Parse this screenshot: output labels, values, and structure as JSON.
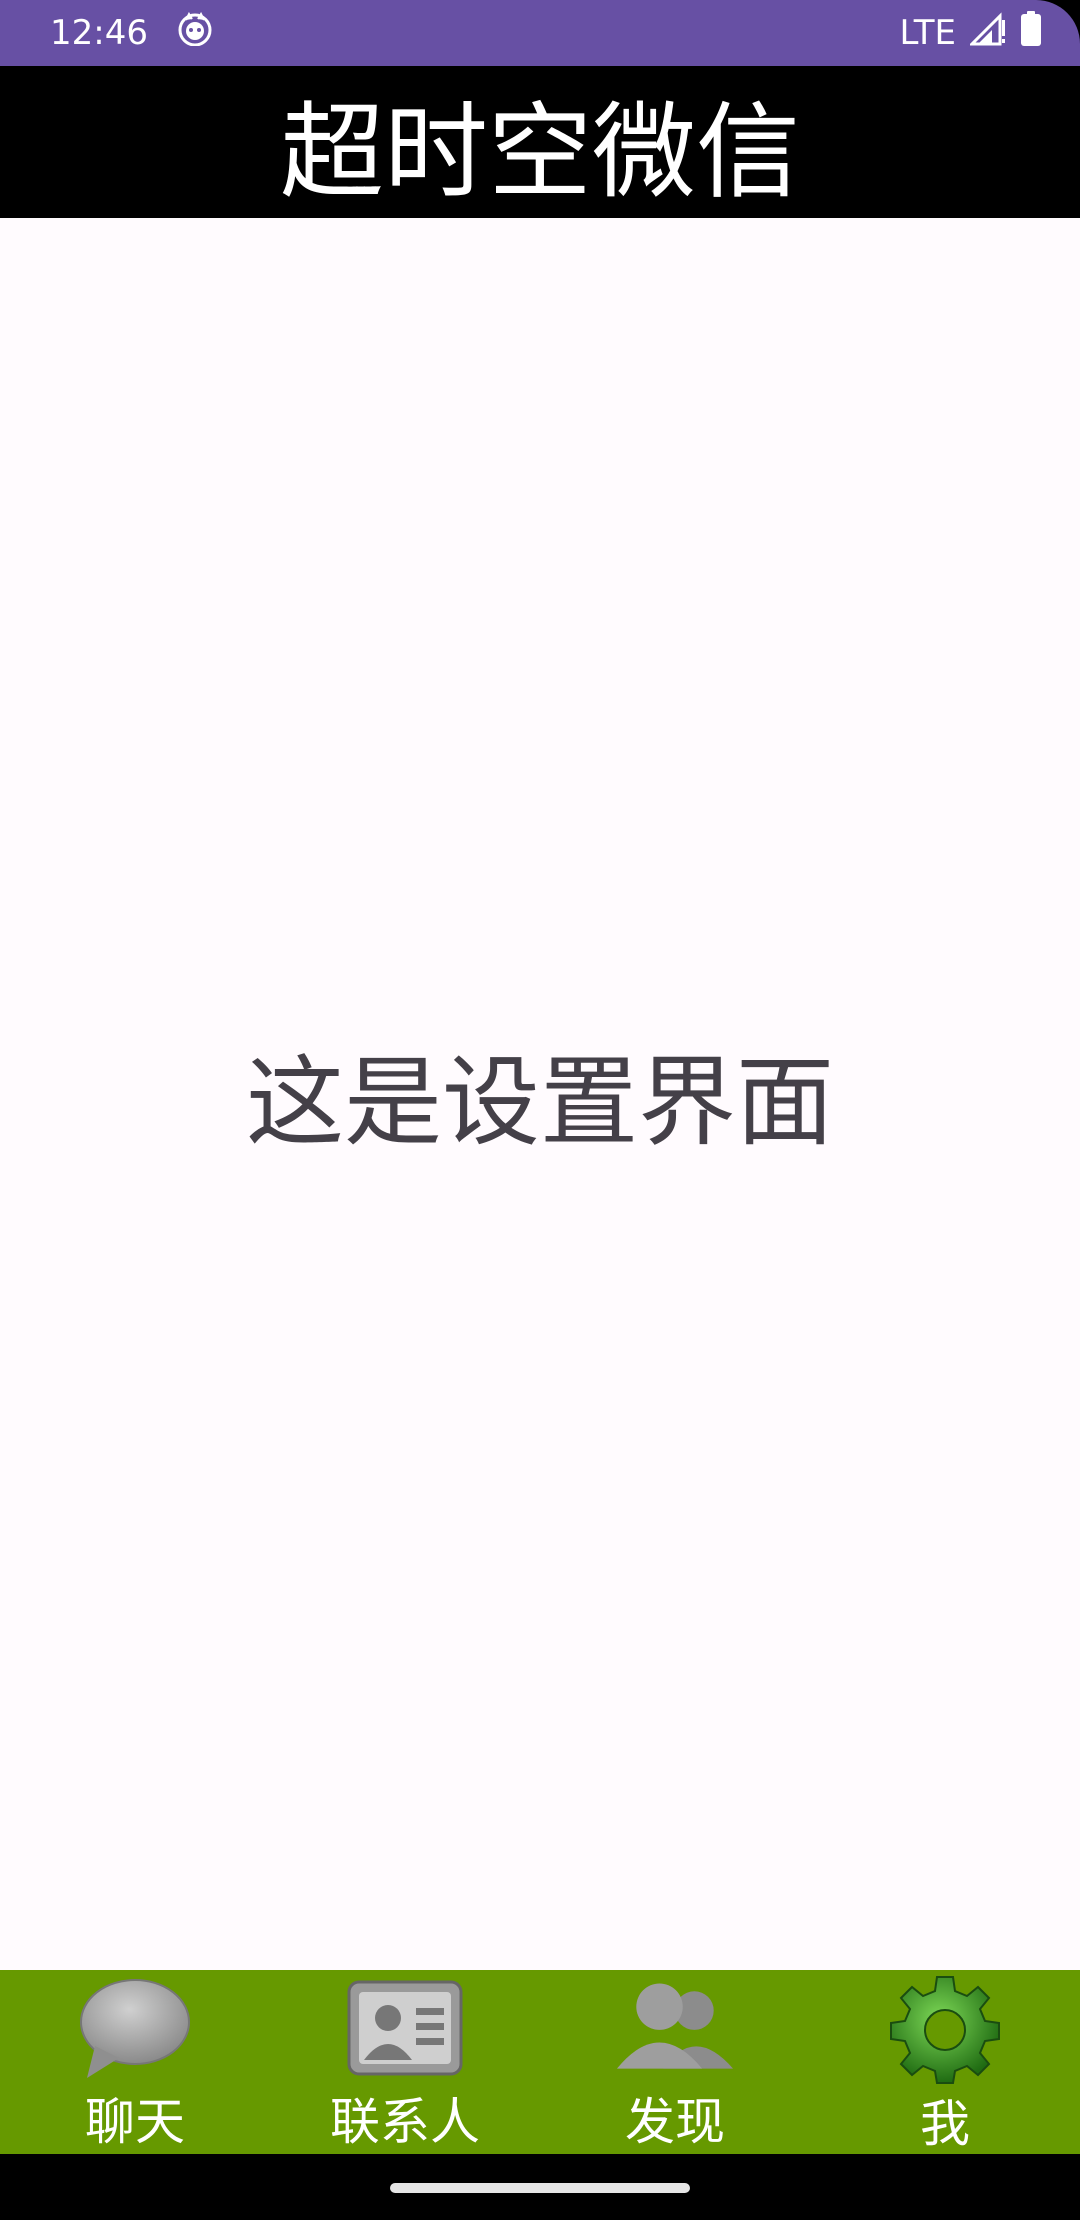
{
  "status_bar": {
    "time": "12:46",
    "network": "LTE",
    "app_icon": "cat-face-icon",
    "signal_icon": "signal-icon",
    "battery_icon": "battery-icon"
  },
  "header": {
    "title": "超时空微信"
  },
  "main": {
    "message": "这是设置界面"
  },
  "bottom_nav": {
    "items": [
      {
        "label": "聊天",
        "icon": "chat-bubble-icon"
      },
      {
        "label": "联系人",
        "icon": "contact-card-icon"
      },
      {
        "label": "发现",
        "icon": "people-icon"
      },
      {
        "label": "我",
        "icon": "gear-icon"
      }
    ]
  },
  "colors": {
    "status_bar": "#6750a4",
    "header_bg": "#000000",
    "content_bg": "#fffbfe",
    "nav_bg": "#669900",
    "gear_green": "#3c9a1a"
  }
}
